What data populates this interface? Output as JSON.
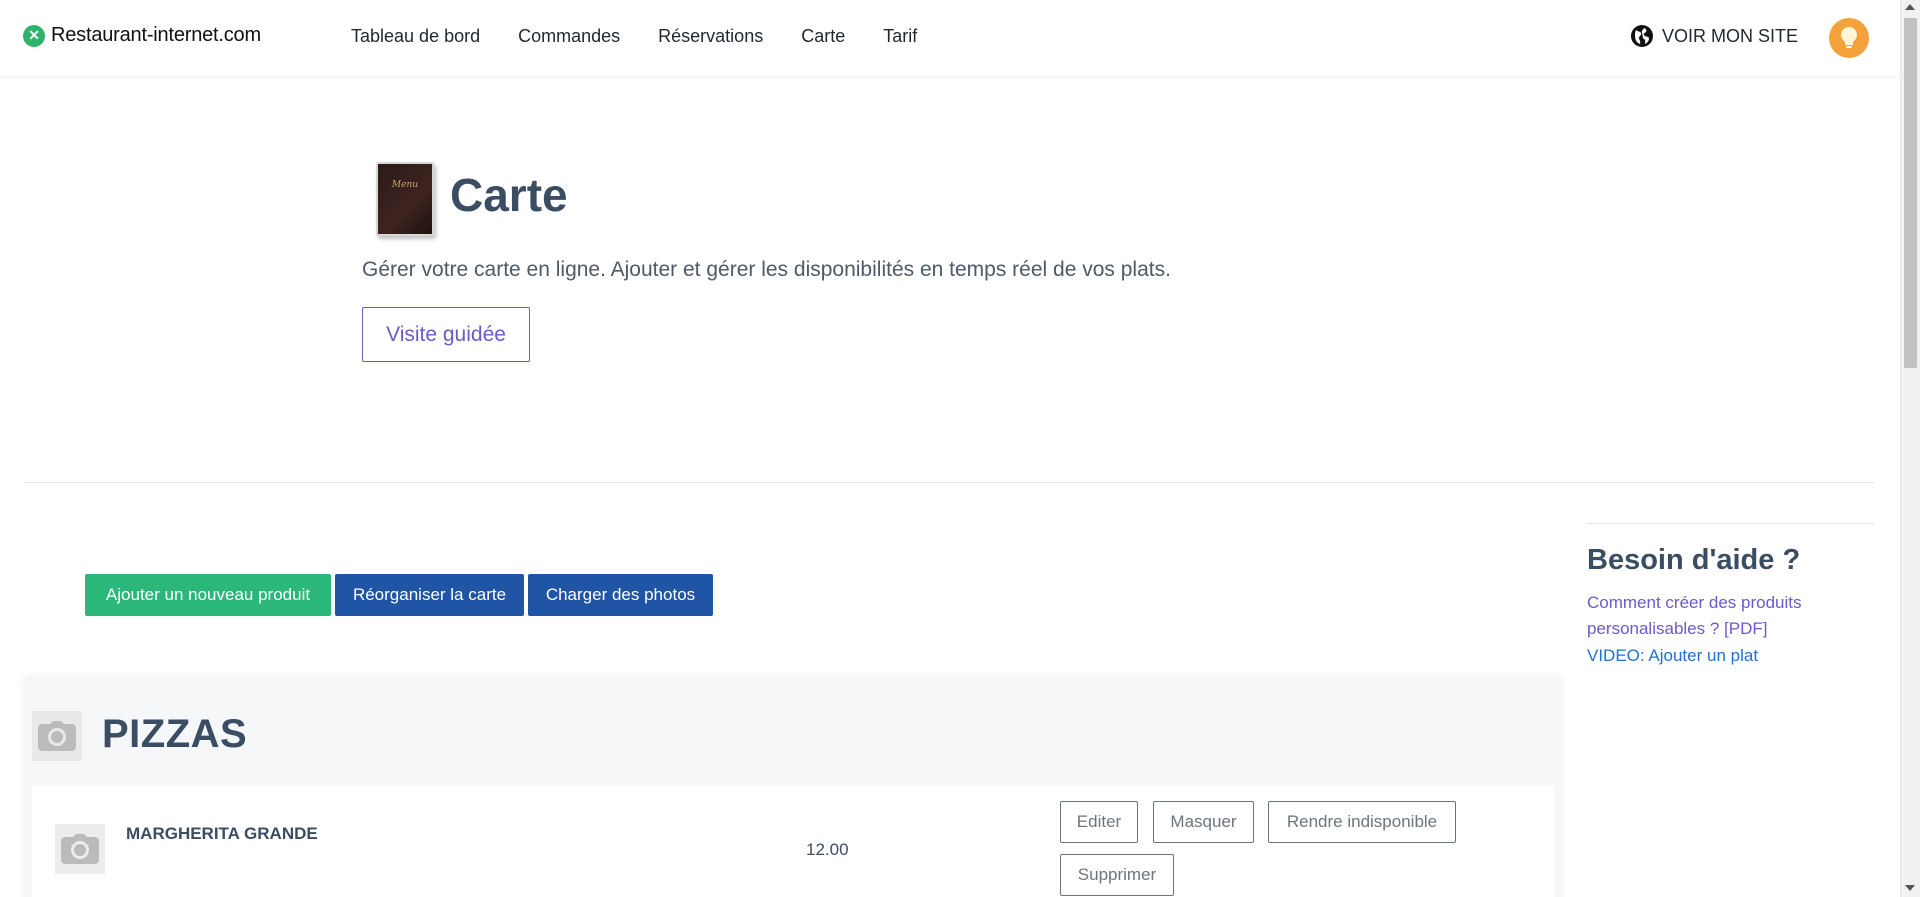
{
  "brand": {
    "name": "Restaurant-internet.com"
  },
  "nav": {
    "items": [
      {
        "label": "Tableau de bord"
      },
      {
        "label": "Commandes"
      },
      {
        "label": "Réservations"
      },
      {
        "label": "Carte"
      },
      {
        "label": "Tarif"
      }
    ],
    "site_link": "VOIR MON SITE"
  },
  "hero": {
    "icon_text": "Menu",
    "title": "Carte",
    "subtitle": "Gérer votre carte en ligne. Ajouter et gérer les disponibilités en temps réel de vos plats.",
    "tour_button": "Visite guidée"
  },
  "actions": {
    "add_product": "Ajouter un nouveau produit",
    "reorganize": "Réorganiser la carte",
    "upload_photos": "Charger des photos"
  },
  "category": {
    "title": "PIZZAS",
    "products": [
      {
        "name": "MARGHERITA GRANDE",
        "price": "12.00",
        "buttons": {
          "edit": "Editer",
          "hide": "Masquer",
          "unavailable": "Rendre indisponible",
          "delete": "Supprimer"
        }
      }
    ]
  },
  "help": {
    "title": "Besoin d'aide ?",
    "link_pdf": "Comment créer des produits personalisables ? [PDF]",
    "link_video": "VIDEO: Ajouter un plat"
  },
  "colors": {
    "green": "#2bb67a",
    "blue": "#1f55a4",
    "purple_link": "#6a5acd",
    "title_text": "#3b4d63",
    "avatar": "#f5a13c"
  }
}
